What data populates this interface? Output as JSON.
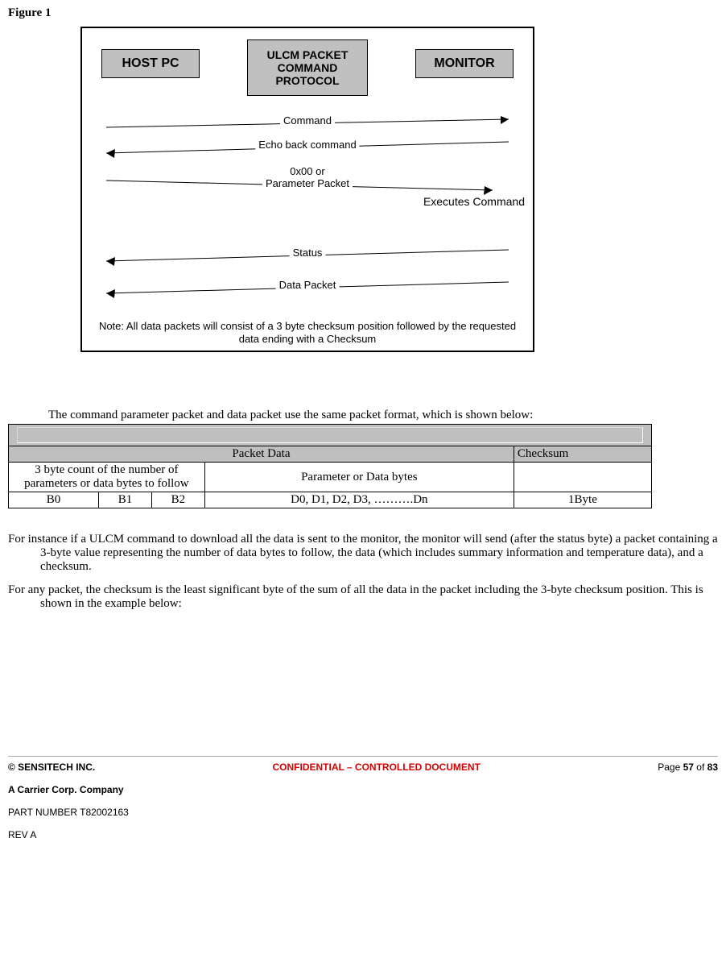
{
  "figure": {
    "title": "Figure 1",
    "host_label": "HOST PC",
    "protocol_label": "ULCM PACKET COMMAND PROTOCOL",
    "monitor_label": "MONITOR",
    "arrows": {
      "command": "Command",
      "echo": "Echo back command",
      "param_l1": "0x00 or",
      "param_l2": "Parameter Packet",
      "status": "Status",
      "data": "Data Packet"
    },
    "executes": "Executes Command",
    "note": "Note: All data packets will consist of a 3 byte checksum position followed by the requested data ending with a Checksum"
  },
  "para_intro_1": "The command parameter packet and data packet use the same packet format, which is shown below:",
  "packet_table": {
    "head_packet_data": "Packet Data",
    "head_checksum": "Checksum",
    "desc_count": "3 byte count of the number of parameters or data bytes to follow",
    "desc_param": "Parameter or Data bytes",
    "b0": "B0",
    "b1": "B1",
    "b2": "B2",
    "dn": "D0, D1, D2, D3, ……….Dn",
    "ck": "1Byte"
  },
  "para2": "For instance if a ULCM command to download all the data is sent to the monitor, the monitor will send (after the status byte) a packet containing a 3-byte value representing the number of data bytes to follow, the data (which includes summary information and temperature data), and a checksum.",
  "para3": "For any packet, the checksum is the least significant byte of the sum of all the data in the packet including the 3-byte checksum position.  This is shown in the example below:",
  "footer": {
    "company": "© SENSITECH INC.",
    "confidential": "CONFIDENTIAL – CONTROLLED DOCUMENT",
    "page_prefix": "Page ",
    "page_num": "57",
    "page_of": " of ",
    "page_total": "83",
    "carrier": "A Carrier Corp. Company",
    "part": "PART NUMBER T82002163",
    "rev": "REV A"
  }
}
